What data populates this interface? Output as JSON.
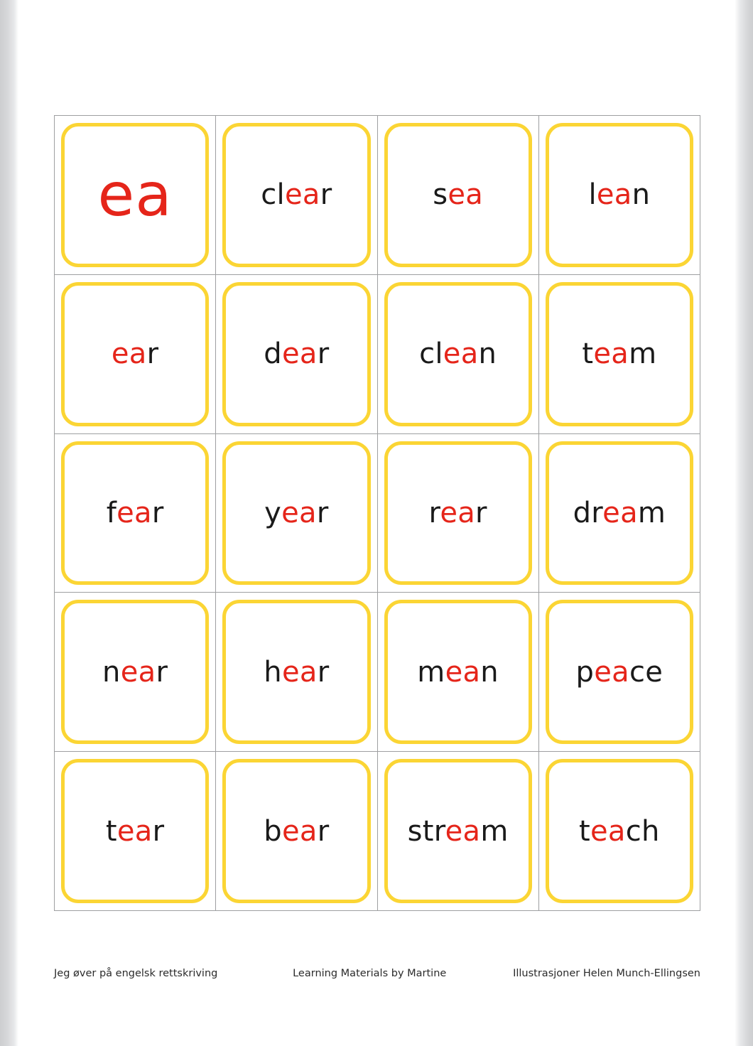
{
  "page": {
    "background_color": "#ffffff",
    "viewer_background_color": "#d9dadc"
  },
  "theme": {
    "card_border_color": "#fbd534",
    "highlight_color": "#e5251a",
    "text_color": "#1a1a1a",
    "grid_line_color": "#9e9fa1"
  },
  "worksheet": {
    "phoneme": "ea",
    "columns": 4,
    "rows": 5,
    "cards": [
      {
        "word": "ea",
        "prefix": "",
        "highlight": "ea",
        "suffix": "",
        "header": true
      },
      {
        "word": "clear",
        "prefix": "cl",
        "highlight": "ea",
        "suffix": "r",
        "header": false
      },
      {
        "word": "sea",
        "prefix": "s",
        "highlight": "ea",
        "suffix": "",
        "header": false
      },
      {
        "word": "lean",
        "prefix": "l",
        "highlight": "ea",
        "suffix": "n",
        "header": false
      },
      {
        "word": "ear",
        "prefix": "",
        "highlight": "ea",
        "suffix": "r",
        "header": false
      },
      {
        "word": "dear",
        "prefix": "d",
        "highlight": "ea",
        "suffix": "r",
        "header": false
      },
      {
        "word": "clean",
        "prefix": "cl",
        "highlight": "ea",
        "suffix": "n",
        "header": false
      },
      {
        "word": "team",
        "prefix": "t",
        "highlight": "ea",
        "suffix": "m",
        "header": false
      },
      {
        "word": "fear",
        "prefix": "f",
        "highlight": "ea",
        "suffix": "r",
        "header": false
      },
      {
        "word": "year",
        "prefix": "y",
        "highlight": "ea",
        "suffix": "r",
        "header": false
      },
      {
        "word": "rear",
        "prefix": "r",
        "highlight": "ea",
        "suffix": "r",
        "header": false
      },
      {
        "word": "dream",
        "prefix": "dr",
        "highlight": "ea",
        "suffix": "m",
        "header": false
      },
      {
        "word": "near",
        "prefix": "n",
        "highlight": "ea",
        "suffix": "r",
        "header": false
      },
      {
        "word": "hear",
        "prefix": "h",
        "highlight": "ea",
        "suffix": "r",
        "header": false
      },
      {
        "word": "mean",
        "prefix": "m",
        "highlight": "ea",
        "suffix": "n",
        "header": false
      },
      {
        "word": "peace",
        "prefix": "p",
        "highlight": "ea",
        "suffix": "ce",
        "header": false
      },
      {
        "word": "tear",
        "prefix": "t",
        "highlight": "ea",
        "suffix": "r",
        "header": false
      },
      {
        "word": "bear",
        "prefix": "b",
        "highlight": "ea",
        "suffix": "r",
        "header": false
      },
      {
        "word": "stream",
        "prefix": "str",
        "highlight": "ea",
        "suffix": "m",
        "header": false
      },
      {
        "word": "teach",
        "prefix": "t",
        "highlight": "ea",
        "suffix": "ch",
        "header": false
      }
    ]
  },
  "footer": {
    "left": "Jeg øver på engelsk rettskriving",
    "middle": "Learning Materials by Martine",
    "right": "Illustrasjoner Helen Munch-Ellingsen"
  }
}
